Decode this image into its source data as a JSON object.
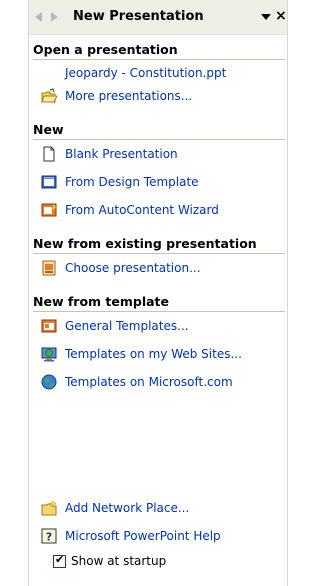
{
  "title": "New Presentation",
  "nav": {
    "back_icon": "back-arrow-icon",
    "forward_icon": "forward-arrow-icon",
    "menu_icon": "dropdown-arrow-icon",
    "close_label": "×"
  },
  "sections": {
    "open": {
      "heading": "Open a presentation",
      "recent_file": "Jeopardy - Constitution.ppt",
      "more": "More presentations..."
    },
    "new": {
      "heading": "New",
      "blank": "Blank Presentation",
      "design": "From Design Template",
      "autocontent": "From AutoContent Wizard"
    },
    "existing": {
      "heading": "New from existing presentation",
      "choose": "Choose presentation..."
    },
    "template": {
      "heading": "New from template",
      "general": "General Templates...",
      "web_sites": "Templates on my Web Sites...",
      "microsoft": "Templates on Microsoft.com"
    }
  },
  "footer": {
    "network": "Add Network Place...",
    "help": "Microsoft PowerPoint Help",
    "startup_label": "Show at startup",
    "startup_checked": true
  }
}
